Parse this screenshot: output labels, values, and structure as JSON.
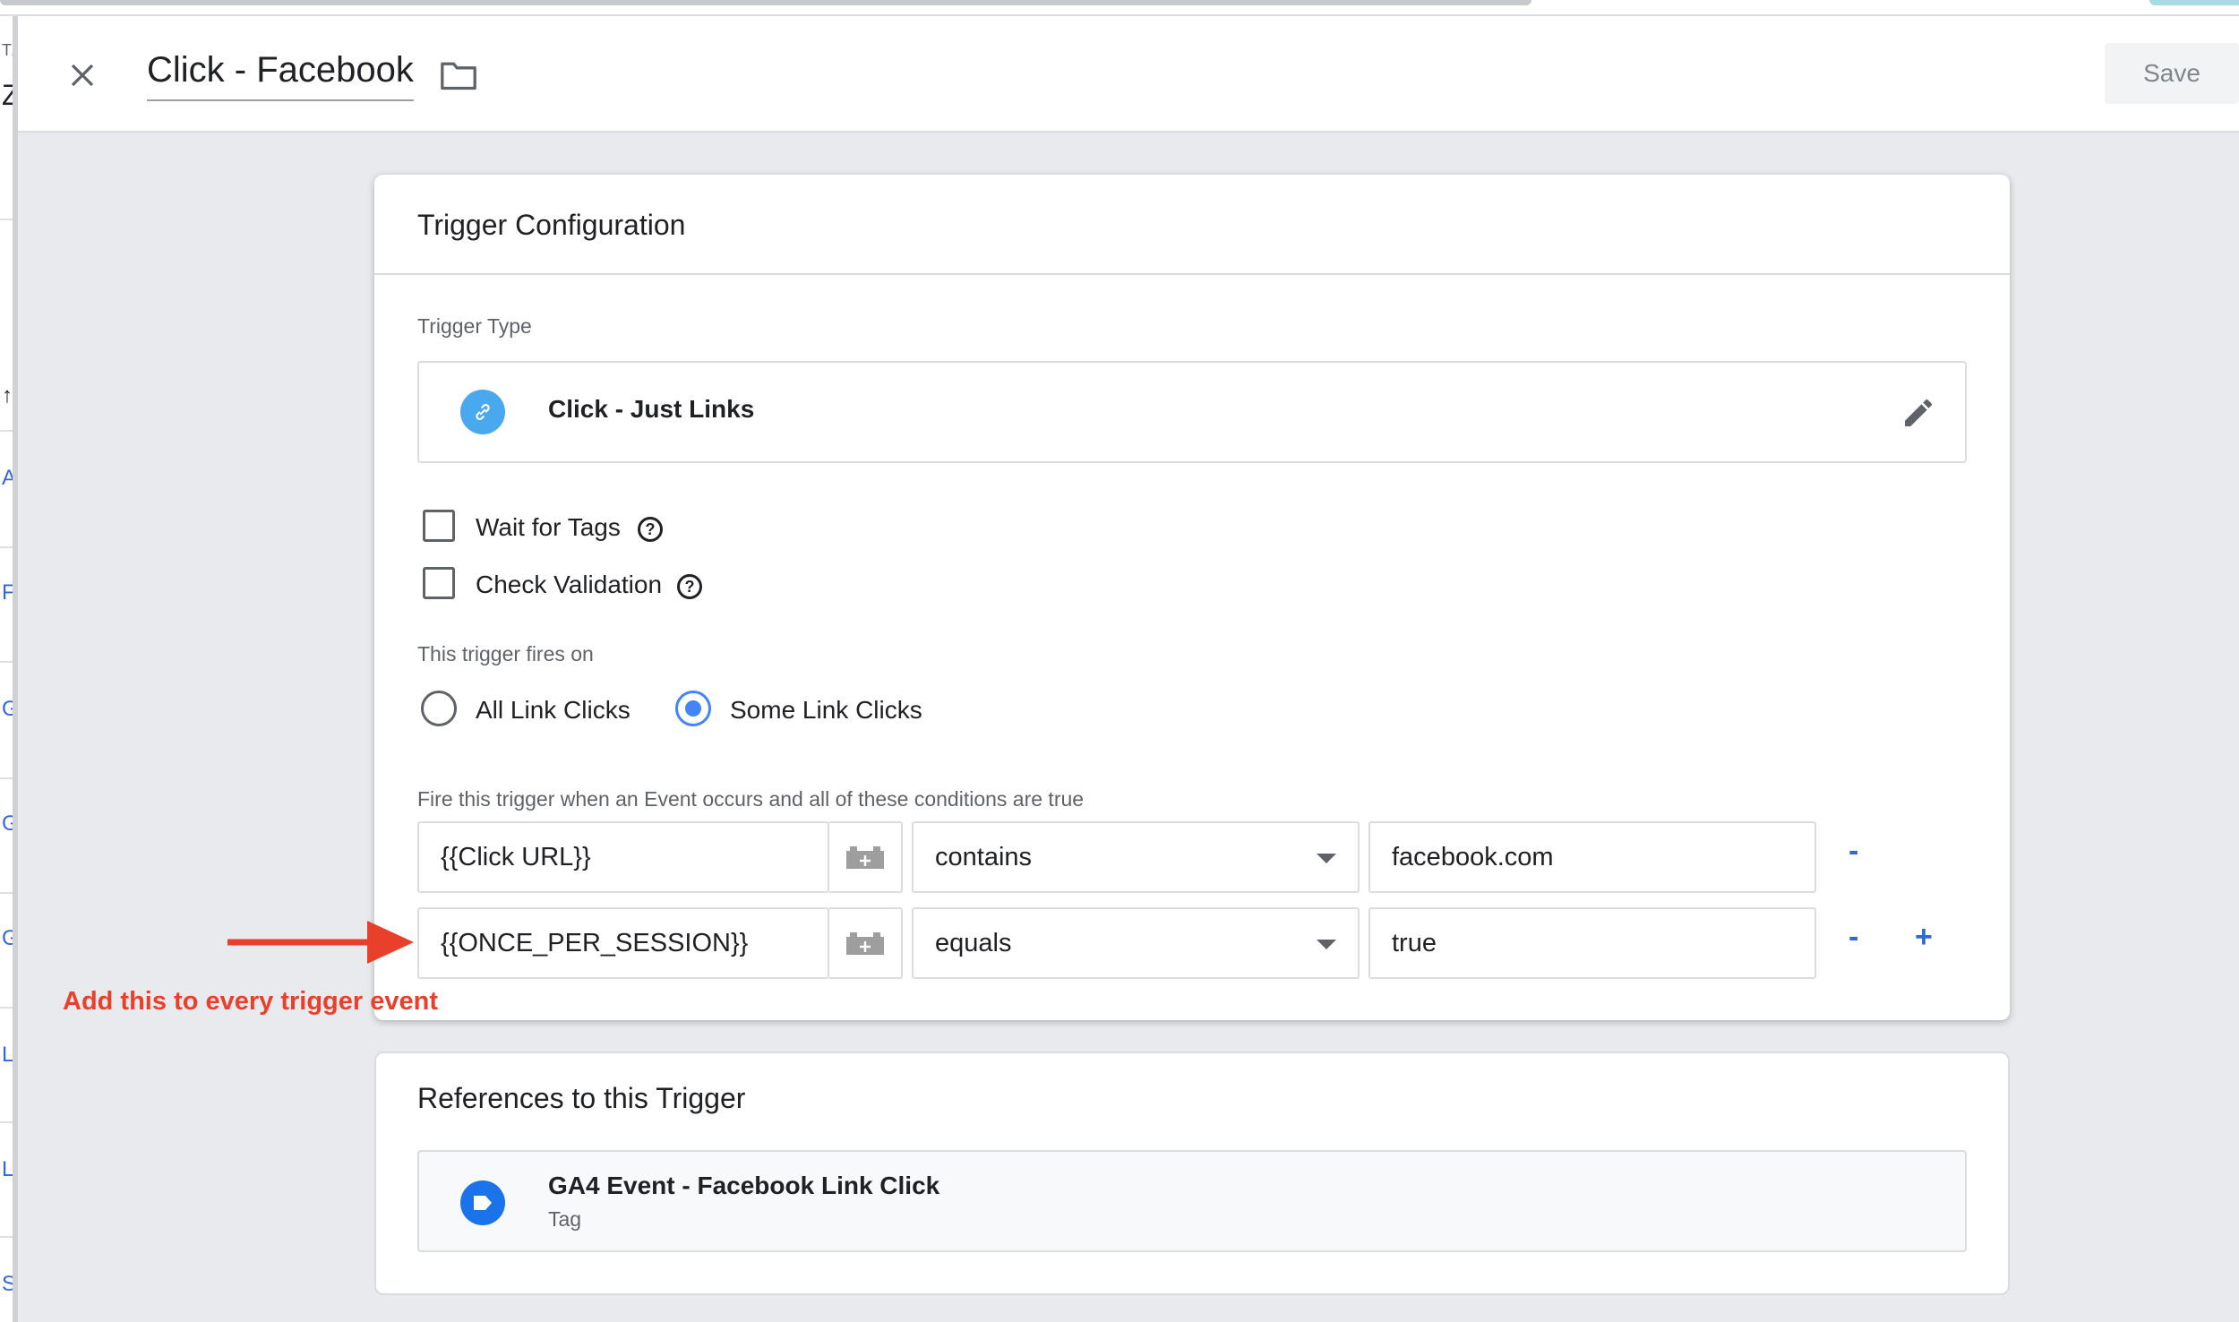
{
  "header": {
    "title": "Click - Facebook",
    "save_label": "Save"
  },
  "left_strip": {
    "letters": [
      "TZ",
      "Z",
      "↑",
      "A",
      "F",
      "G",
      "G",
      "G",
      "L",
      "L",
      "S"
    ]
  },
  "trigger_config": {
    "title": "Trigger Configuration",
    "trigger_type_label": "Trigger Type",
    "trigger_type_value": "Click - Just Links",
    "trigger_type_icon": "link-icon",
    "options": [
      {
        "label": "Wait for Tags",
        "checked": false
      },
      {
        "label": "Check Validation",
        "checked": false
      }
    ],
    "fires_on_label": "This trigger fires on",
    "fires_on_options": [
      {
        "label": "All Link Clicks",
        "selected": false
      },
      {
        "label": "Some Link Clicks",
        "selected": true
      }
    ],
    "conditions_label": "Fire this trigger when an Event occurs and all of these conditions are true",
    "conditions": [
      {
        "variable": "{{Click URL}}",
        "operator": "contains",
        "value": "facebook.com",
        "remove": "-"
      },
      {
        "variable": "{{ONCE_PER_SESSION}}",
        "operator": "equals",
        "value": "true",
        "remove": "-",
        "add": "+"
      }
    ]
  },
  "annotation": {
    "text": "Add this to every trigger event",
    "color": "#e8402a"
  },
  "references": {
    "title": "References to this Trigger",
    "items": [
      {
        "name": "GA4 Event - Facebook Link Click",
        "kind": "Tag"
      }
    ]
  },
  "colors": {
    "accent": "#4285f4",
    "link_icon_bg": "#4aa9ee",
    "tag_icon_bg": "#1a73e8"
  }
}
